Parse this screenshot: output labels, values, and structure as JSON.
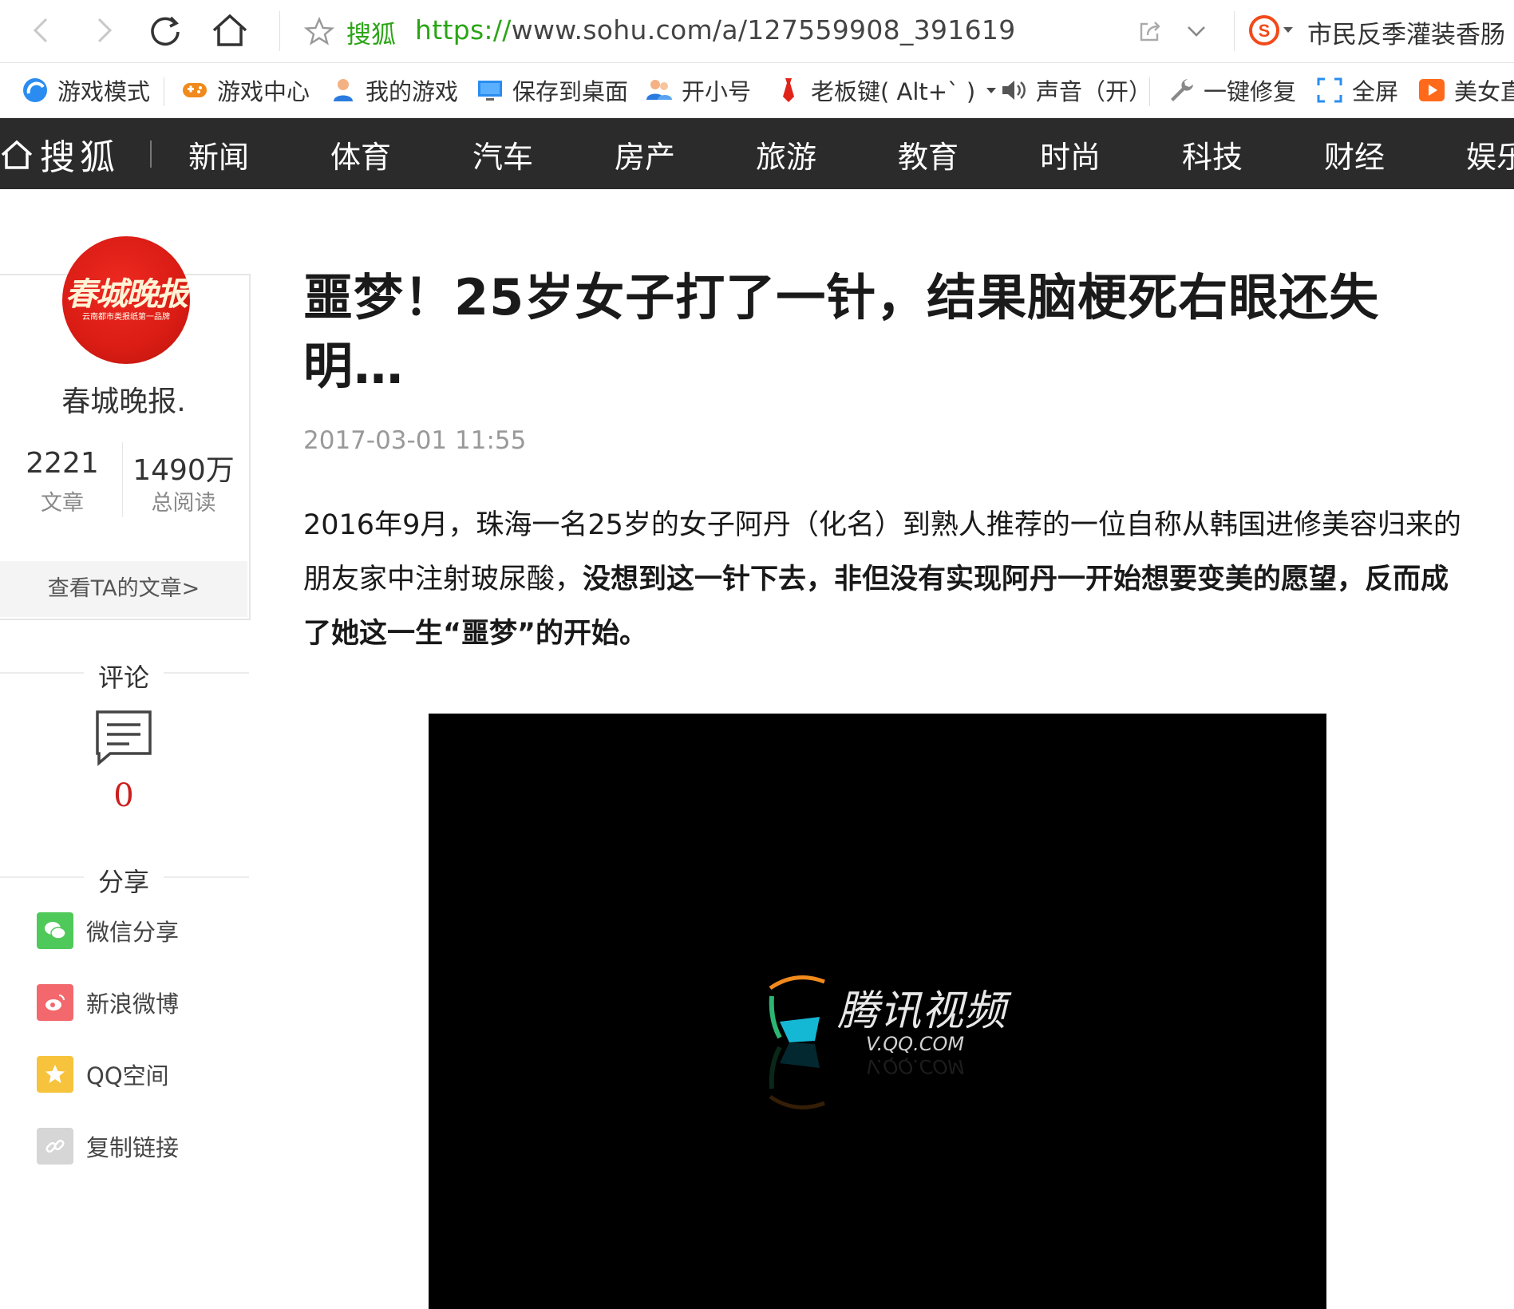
{
  "browser": {
    "back_icon": "chevron-left-icon",
    "forward_icon": "chevron-right-icon",
    "reload_icon": "reload-icon",
    "home_icon": "home-icon",
    "bookmark_icon": "star-icon",
    "site_label": "搜狐",
    "url_scheme": "https://",
    "url_rest": "www.sohu.com/a/127559908_391619",
    "search_hint": "市民反季灌装香肠"
  },
  "toolbar": {
    "items": [
      {
        "label": "游戏模式",
        "icon": "game-mode-icon"
      },
      {
        "label": "游戏中心",
        "icon": "gamepad-icon"
      },
      {
        "label": "我的游戏",
        "icon": "user-icon"
      },
      {
        "label": "保存到桌面",
        "icon": "monitor-icon"
      },
      {
        "label": "开小号",
        "icon": "users-icon"
      },
      {
        "label": "老板键( Alt+` )",
        "icon": "tie-icon"
      },
      {
        "label": "声音（开）",
        "icon": "speaker-icon"
      },
      {
        "label": "一键修复",
        "icon": "wrench-icon"
      },
      {
        "label": "全屏",
        "icon": "fullscreen-icon"
      },
      {
        "label": "美女直",
        "icon": "play-icon"
      }
    ]
  },
  "site_nav": {
    "logo": "搜狐",
    "links": [
      "新闻",
      "体育",
      "汽车",
      "房产",
      "旅游",
      "教育",
      "时尚",
      "科技",
      "财经",
      "娱乐"
    ]
  },
  "author": {
    "avatar_text": "春城晚报",
    "avatar_tag": "云南都市类报纸第一品牌",
    "name": "春城晚报.",
    "articles_count": "2221",
    "articles_label": "文章",
    "reads_count": "1490万",
    "reads_label": "总阅读",
    "view_articles": "查看TA的文章>"
  },
  "comments": {
    "heading": "评论",
    "count": "0"
  },
  "share": {
    "heading": "分享",
    "items": [
      {
        "label": "微信分享",
        "icon": "wechat-icon",
        "color": "#4fc95a"
      },
      {
        "label": "新浪微博",
        "icon": "weibo-icon",
        "color": "#f2686c"
      },
      {
        "label": "QQ空间",
        "icon": "qzone-icon",
        "color": "#f7c33c"
      },
      {
        "label": "复制链接",
        "icon": "link-icon",
        "color": "#d6d6d6"
      }
    ]
  },
  "article": {
    "title": "噩梦！25岁女子打了一针，结果脑梗死右眼还失明…",
    "date": "2017-03-01 11:55",
    "lede_normal": "2016年9月，珠海一名25岁的女子阿丹（化名）到熟人推荐的一位自称从韩国进修美容归来的朋友家中注射玻尿酸，",
    "lede_bold": "没想到这一针下去，非但没有实现阿丹一开始想要变美的愿望，反而成了她这一生“噩梦”的开始。"
  },
  "video": {
    "brand": "腾讯视频",
    "url": "V.QQ.COM"
  },
  "colors": {
    "nav_bg": "#2b2b2b",
    "url_green": "#2aa515",
    "comment_red": "#cc1f1f"
  }
}
